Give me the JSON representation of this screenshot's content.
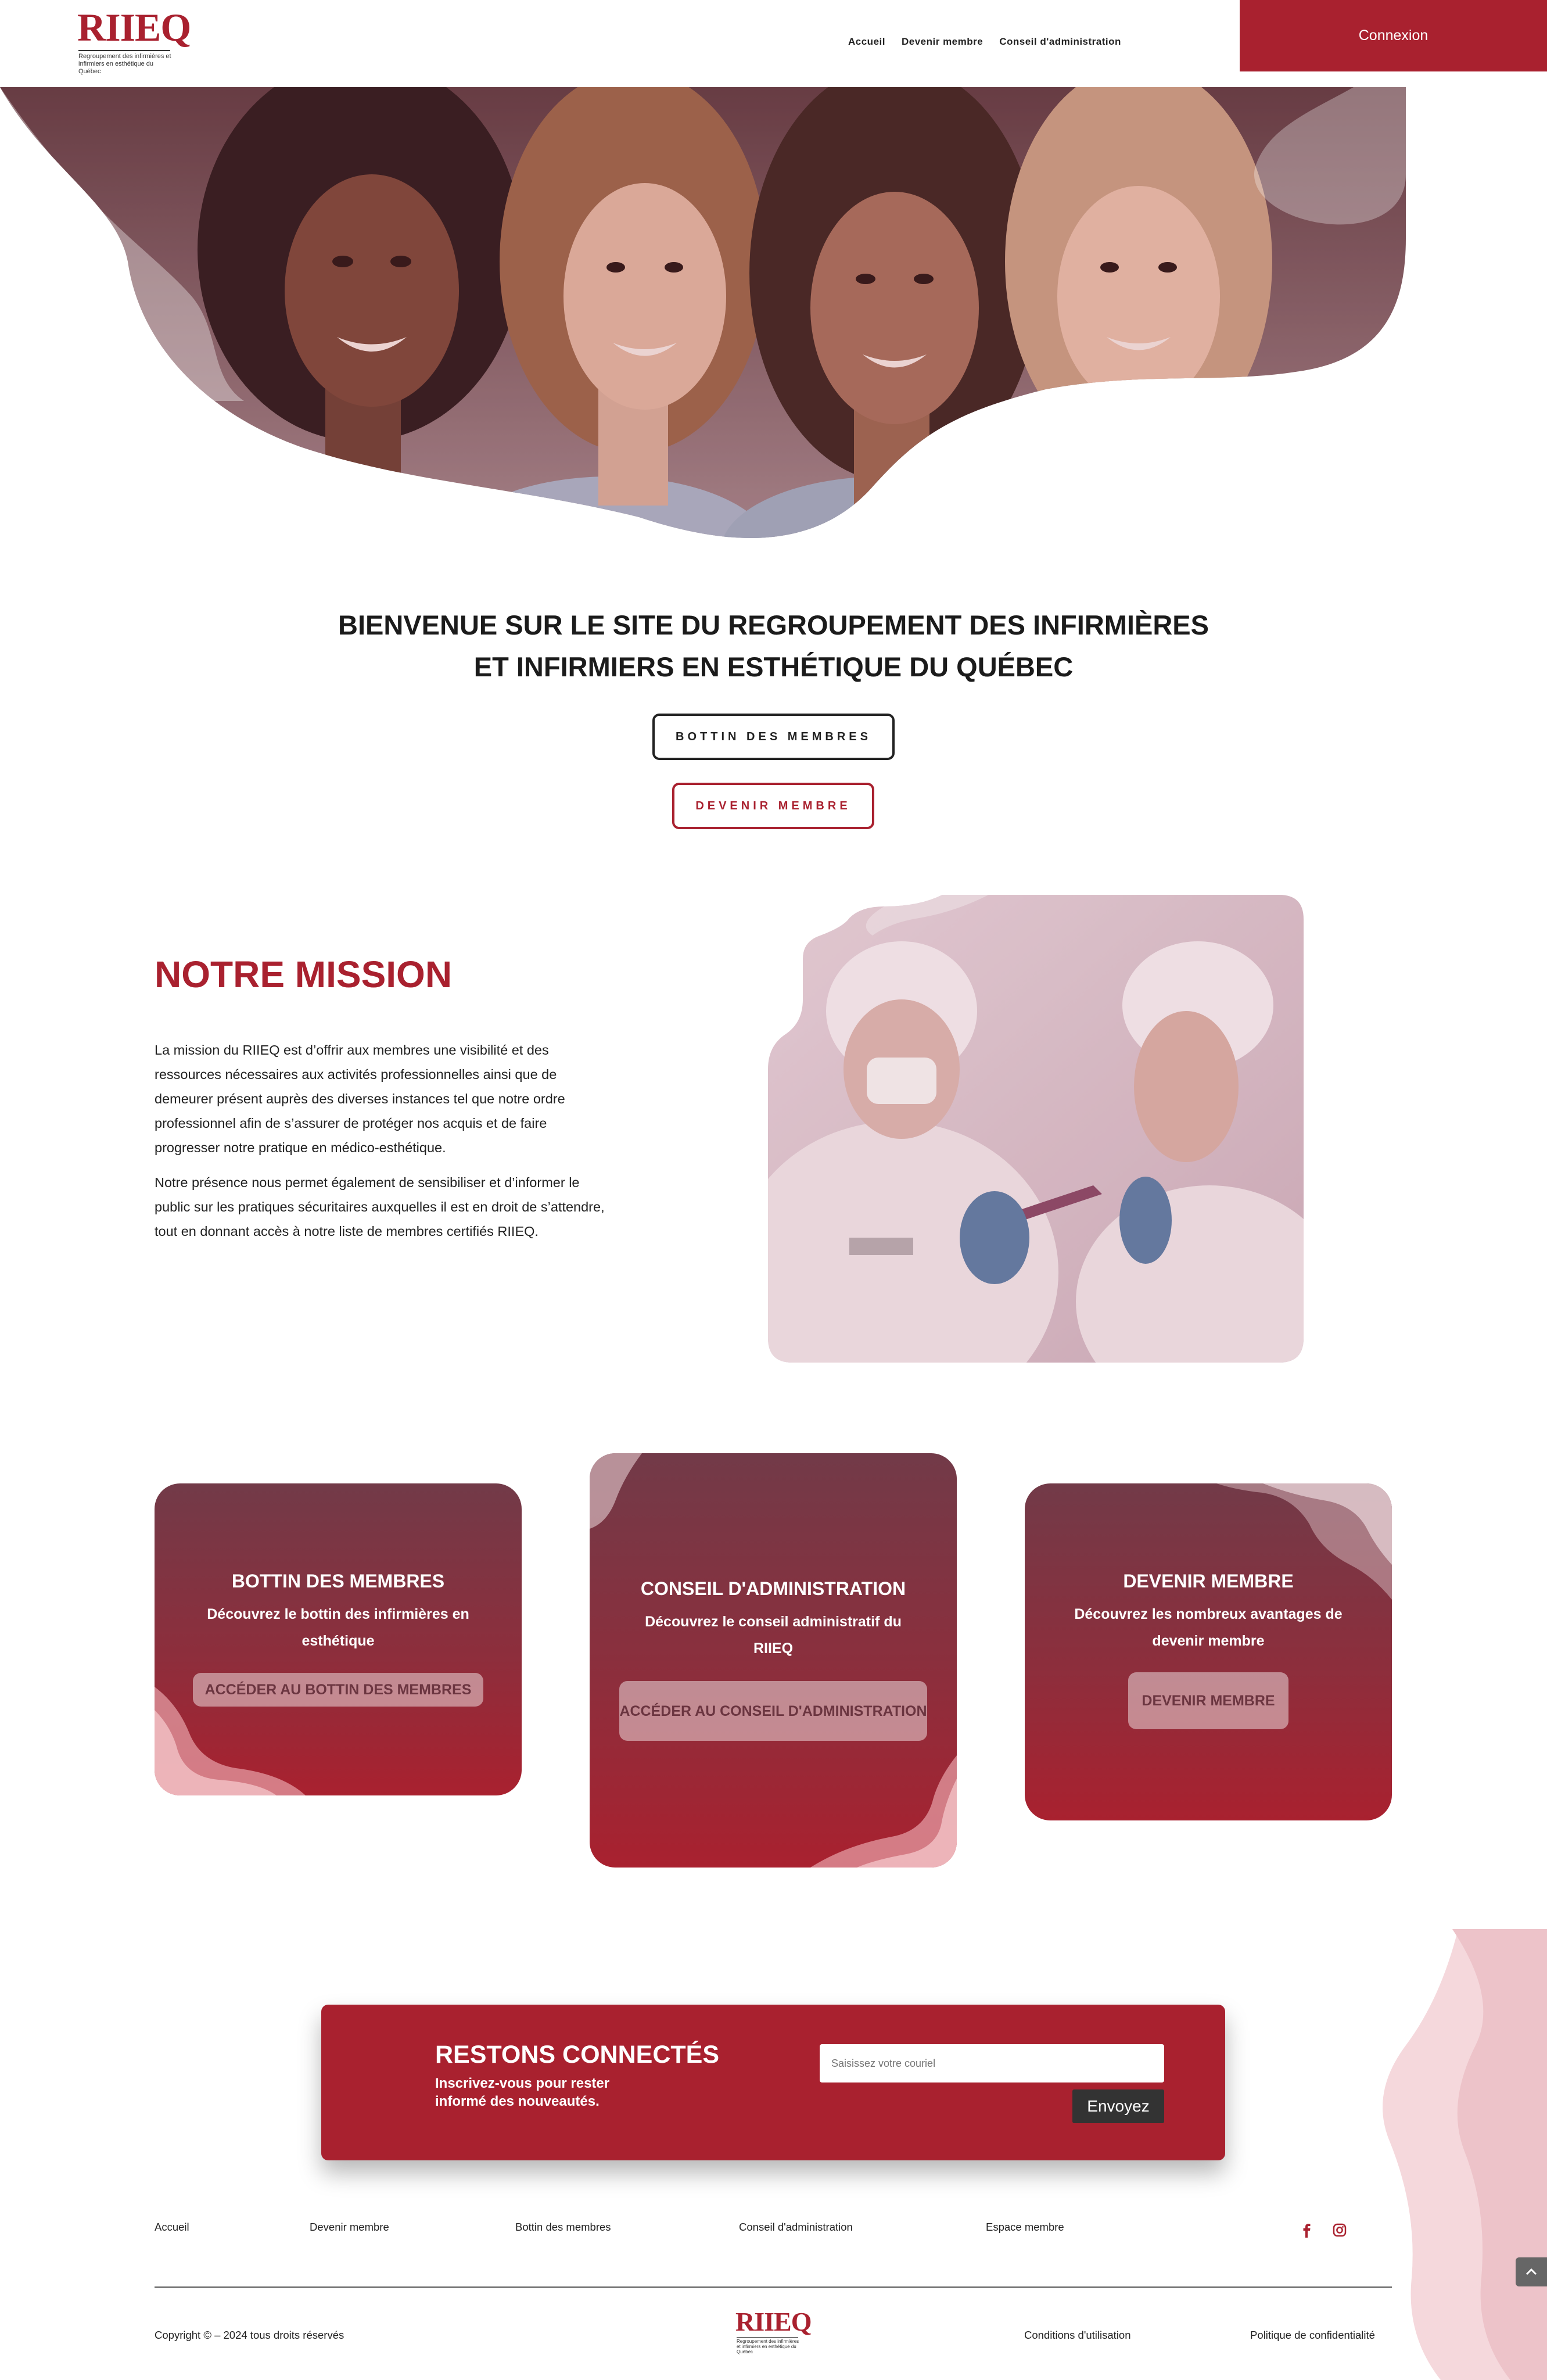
{
  "header": {
    "logo_text": "RIIEQ",
    "logo_sub": "Regroupement des infirmières et infirmiers en esthétique du Québec",
    "nav": [
      "Accueil",
      "Devenir membre",
      "Conseil d'administration"
    ],
    "login_label": "Connexion"
  },
  "welcome": {
    "title_line1": "BIENVENUE SUR LE SITE DU REGROUPEMENT DES INFIRMIÈRES",
    "title_line2": "ET INFIRMIERS EN ESTHÉTIQUE DU QUÉBEC",
    "btn_bottin": "BOTTIN DES MEMBRES",
    "btn_devenir": "DEVENIR MEMBRE"
  },
  "mission": {
    "title": "NOTRE MISSION",
    "p1": "La mission du RIIEQ est d’offrir aux membres une visibilité et des ressources nécessaires aux activités professionnelles ainsi que de demeurer présent auprès des diverses instances tel que notre ordre professionnel afin de s’assurer de protéger nos acquis et de faire progresser notre pratique en médico-esthétique.",
    "p2": "Notre présence nous permet également de sensibiliser et d’informer le public sur les pratiques sécuritaires auxquelles il est en droit de s’attendre, tout en donnant accès à notre liste de membres certifiés RIIEQ."
  },
  "cards": [
    {
      "title": "BOTTIN DES MEMBRES",
      "desc": "Découvrez le bottin des infirmières en esthétique",
      "btn": "ACCÉDER AU BOTTIN DES MEMBRES"
    },
    {
      "title": "CONSEIL D'ADMINISTRATION",
      "desc": "Découvrez le conseil administratif du RIIEQ",
      "btn": "ACCÉDER AU CONSEIL D'ADMINISTRATION"
    },
    {
      "title": "DEVENIR MEMBRE",
      "desc": "Découvrez les nombreux avantages de devenir membre",
      "btn": "DEVENIR MEMBRE"
    }
  ],
  "newsletter": {
    "title": "RESTONS CONNECTÉS",
    "desc": "Inscrivez-vous pour rester informé des nouveautés.",
    "placeholder": "Saisissez votre couriel",
    "send": "Envoyez"
  },
  "footer": {
    "nav": [
      "Accueil",
      "Devenir membre",
      "Bottin des membres",
      "Conseil d'administration",
      "Espace membre"
    ],
    "copyright": "Copyright © – 2024 tous droits réservés",
    "terms": "Conditions d'utilisation",
    "privacy": "Politique de confidentialité",
    "social": [
      "facebook-icon",
      "instagram-icon"
    ]
  },
  "colors": {
    "brand": "#a9212f",
    "card_top": "#723a48",
    "dark_button": "#333333"
  }
}
